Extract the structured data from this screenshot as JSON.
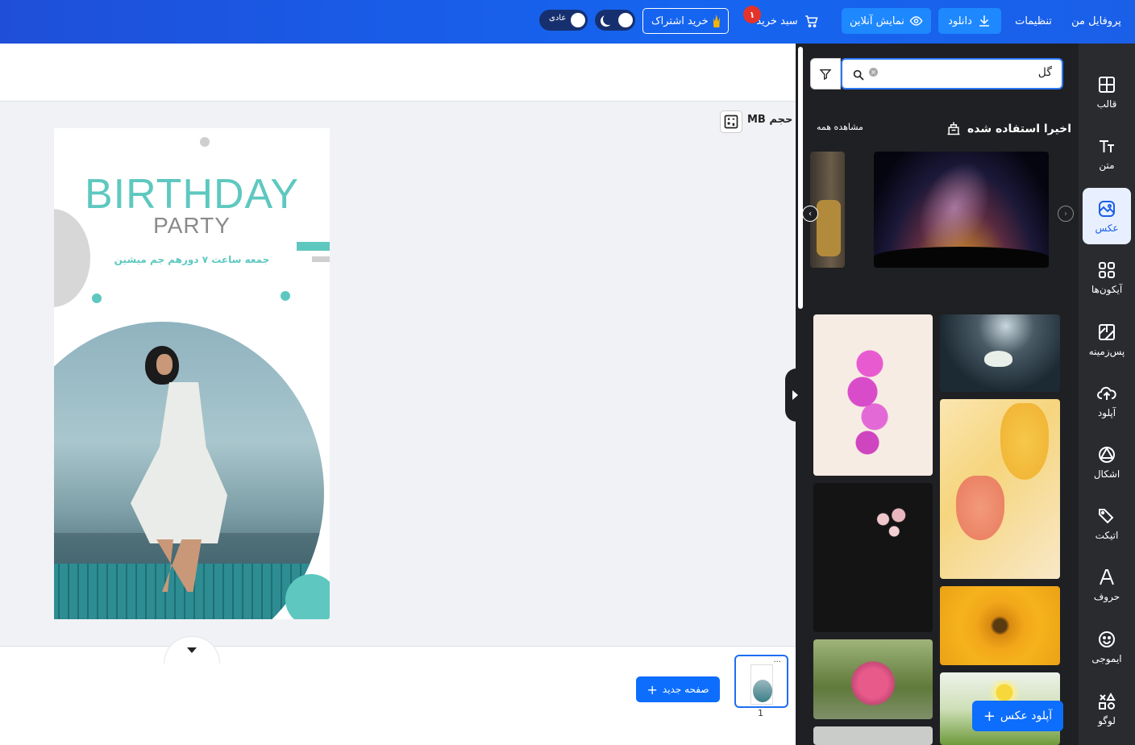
{
  "topbar": {
    "profile": "پروفایل من",
    "settings": "تنظیمات",
    "download": "دانلود",
    "online_preview": "نمایش آنلاین",
    "cart": "سبد خرید",
    "cart_count": "۱",
    "subscribe": "خرید اشتراک",
    "normal_label": "عادی"
  },
  "workspace": {
    "size_label": "حجم MB",
    "new_page": "صفحه جدید",
    "page_number": "1"
  },
  "design": {
    "title": "BIRTHDAY",
    "subtitle": "PARTY",
    "tagline": "جمعه ساعت ۷ دورهم جم میشین",
    "accent_color": "#5ec8c0"
  },
  "panel": {
    "search_value": "گل",
    "recent_title": "اخیرا استفاده شده",
    "see_all": "مشاهده همه",
    "upload_photo": "آپلود عکس"
  },
  "nav": {
    "items": [
      {
        "label": "قالب",
        "icon": "layout-icon"
      },
      {
        "label": "متن",
        "icon": "text-icon"
      },
      {
        "label": "عکس",
        "icon": "photo-icon"
      },
      {
        "label": "آیکون‌ها",
        "icon": "icons-grid-icon"
      },
      {
        "label": "پس‌زمینه",
        "icon": "background-icon"
      },
      {
        "label": "آپلود",
        "icon": "upload-cloud-icon"
      },
      {
        "label": "اشکال",
        "icon": "shapes-icon"
      },
      {
        "label": "اتیکت",
        "icon": "tag-icon"
      },
      {
        "label": "حروف",
        "icon": "font-icon"
      },
      {
        "label": "ایموجی",
        "icon": "emoji-icon"
      },
      {
        "label": "لوگو",
        "icon": "logo-icon"
      }
    ]
  }
}
